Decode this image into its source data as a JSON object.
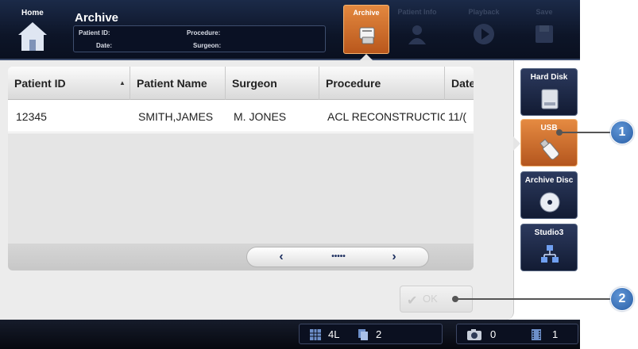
{
  "header": {
    "home_label": "Home",
    "title": "Archive",
    "patient_id_label": "Patient ID:",
    "date_label": "Date:",
    "procedure_label": "Procedure:",
    "surgeon_label": "Surgeon:"
  },
  "tabs": [
    {
      "label": "Archive",
      "icon": "archive-icon",
      "active": true
    },
    {
      "label": "Patient Info",
      "icon": "patient-icon",
      "active": false
    },
    {
      "label": "Playback",
      "icon": "play-icon",
      "active": false
    },
    {
      "label": "Save",
      "icon": "save-icon",
      "active": false
    }
  ],
  "table": {
    "columns": [
      "Patient ID",
      "Patient Name",
      "Surgeon",
      "Procedure",
      "Date"
    ],
    "rows": [
      {
        "patient_id": "12345",
        "patient_name": "SMITH,JAMES",
        "surgeon": "M. JONES",
        "procedure": "ACL RECONSTRUCTION",
        "date": "11/("
      }
    ],
    "pager": {
      "prev": "‹",
      "dots": "•••••",
      "next": "›"
    }
  },
  "ok_button": {
    "label": "OK"
  },
  "side_buttons": [
    {
      "label": "Hard Disk",
      "icon": "hard-disk-icon",
      "active": false
    },
    {
      "label": "USB",
      "icon": "usb-icon",
      "active": true
    },
    {
      "label": "Archive Disc",
      "icon": "disc-icon",
      "active": false
    },
    {
      "label": "Studio3",
      "icon": "network-icon",
      "active": false
    }
  ],
  "callouts": [
    "1",
    "2"
  ],
  "status": {
    "layout_value": "4L",
    "pages_value": "2",
    "photos_value": "0",
    "videos_value": "1"
  },
  "colors": {
    "accent_orange": "#d9742f",
    "header_navy": "#0d1528",
    "callout_blue": "#3b72bd"
  }
}
